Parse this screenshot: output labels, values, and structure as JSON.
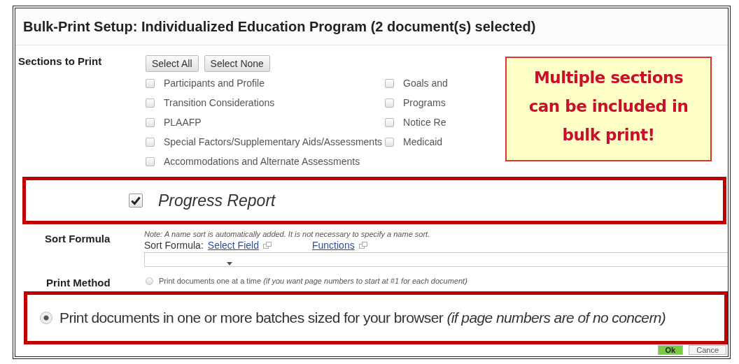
{
  "window": {
    "title": "Bulk-Print Setup: Individualized Education Program (2 document(s) selected)"
  },
  "sections": {
    "label": "Sections to Print",
    "buttons": [
      "Select All",
      "Select None"
    ],
    "columns": [
      [
        {
          "label": "Participants and Profile",
          "checked": false
        },
        {
          "label": "Transition Considerations",
          "checked": false
        },
        {
          "label": "PLAAFP",
          "checked": false
        },
        {
          "label": "Special Factors/Supplementary Aids/Assessments",
          "checked": false
        },
        {
          "label": "Accommodations and Alternate Assessments",
          "checked": false
        }
      ],
      [
        {
          "label": "Goals and",
          "checked": false
        },
        {
          "label": "Programs",
          "checked": false
        },
        {
          "label": "Notice Re",
          "checked": false
        },
        {
          "label": "Medicaid",
          "checked": false
        }
      ]
    ],
    "highlighted": {
      "label": "Progress Report",
      "checked": true
    }
  },
  "callout": {
    "text": "Multiple sections can be included in bulk print!"
  },
  "sort_formula": {
    "label": "Sort Formula",
    "note": "Note: A name sort is automatically added. It is not necessary to specify a name sort.",
    "field_label": "Sort Formula:",
    "links": [
      "Select Field",
      "Functions"
    ]
  },
  "print_method": {
    "label": "Print Method",
    "options": [
      {
        "text": "Print documents one at a time *(if you want page numbers to start at #1 for each document)*",
        "selected": false,
        "highlighted": false
      },
      {
        "text": "Print documents in one or more batches sized for your browser *(if page numbers are of no concern)*",
        "selected": true,
        "highlighted": true
      }
    ]
  },
  "buttons": [
    {
      "label": "Ok",
      "kind": "primary"
    },
    {
      "label": "Cance",
      "kind": "secondary"
    }
  ]
}
